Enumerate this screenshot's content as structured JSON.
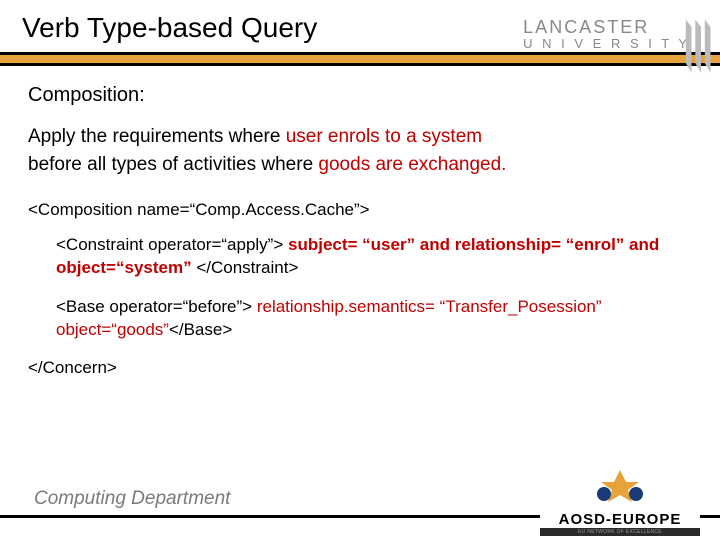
{
  "title": "Verb Type-based Query",
  "logo": {
    "line1": "LANCASTER",
    "line2": "U N I V E R S I T Y"
  },
  "subhead": "Composition:",
  "sentence": {
    "p1": "Apply the requirements where ",
    "p2": "user enrols to a system",
    "p3": "before all types of activities where ",
    "p4": "goods are exchanged."
  },
  "code": {
    "compOpen": "<Composition name=“Comp.Access.Cache”>",
    "constraintOpen": "<Constraint operator=“apply”> ",
    "constraintRed": "subject= “user” and relationship= “enrol” and object=“system”",
    "constraintClose": " </Constraint>",
    "baseOpen": "<Base operator=“before”> ",
    "baseRed": "relationship.semantics= “Transfer_Posession” object=“goods”",
    "baseClose": "</Base>",
    "concernClose": "</Concern>"
  },
  "dept": "Computing Department",
  "aosd": {
    "brand": "AOSD-EUROPE",
    "sub": "EU NETWORK OF EXCELLENCE"
  }
}
